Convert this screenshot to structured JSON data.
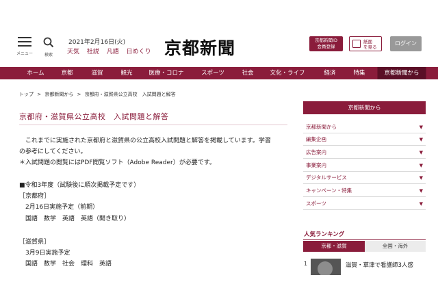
{
  "header": {
    "menu_label": "メニュー",
    "search_label": "検索",
    "date": "2021年2月16日(火)",
    "quick_links": [
      "天気",
      "社説",
      "凡語",
      "日めくり"
    ],
    "logo": "京都新聞",
    "id_button": [
      "京都新聞ID",
      "会員登録"
    ],
    "paper_button": [
      "紙面",
      "を見る"
    ],
    "login_button": "ログイン"
  },
  "nav": {
    "items": [
      "ホーム",
      "京都",
      "滋賀",
      "観光",
      "医療・コロナ",
      "スポーツ",
      "社会",
      "文化・ライフ",
      "経済",
      "特集",
      "京都新聞から"
    ],
    "active_index": 10
  },
  "breadcrumb": [
    "トップ",
    "京都新聞から",
    "京都府・滋賀県公立高校　入試問題と解答"
  ],
  "article": {
    "title": "京都府・滋賀県公立高校　入試問題と解答",
    "lines": [
      "　これまでに実施された京都府と滋賀県の公立高校入試問題と解答を掲載しています。学習",
      "の参考にしてください。",
      "＊入試問題の閲覧にはPDF閲覧ソフト（Adobe Reader）が必要です。",
      "■令和3年度（試験後に順次掲載予定です）",
      "［京都府］",
      "　2月16日実施予定（前期）",
      "　国語　数学　英語　英語（聞き取り）",
      "［滋賀県］",
      "　3月9日実施予定",
      "　国語　数学　社会　理科　英語"
    ]
  },
  "sidebar": {
    "heading": "京都新聞から",
    "items": [
      "京都新聞から",
      "編集企画",
      "広告案内",
      "事業案内",
      "デジタルサービス",
      "キャンペーン・特集",
      "スポーツ"
    ]
  },
  "ranking": {
    "heading": "人気ランキング",
    "tabs": [
      "京都・滋賀",
      "全国・海外"
    ],
    "first_rank": "1",
    "first_title": "滋賀・草津で看護師3人感"
  },
  "colors": {
    "brand": "#8a1c3b",
    "brand_dark": "#5a0f26"
  }
}
